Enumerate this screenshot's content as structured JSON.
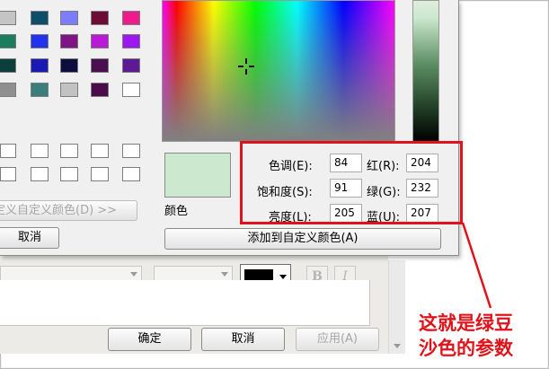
{
  "colors": {
    "accent_red": "#e0131b",
    "sample_color": "#cce8cf"
  },
  "basic_colors_grid": [
    [
      "#c4c4c4",
      "#0d4f6a",
      "#7d7dfc",
      "#6c0d36",
      "#ef1a8b"
    ],
    [
      "#197d5e",
      "#2233f0",
      "#7f1484",
      "#b81ad6",
      "#9c17f0"
    ],
    [
      "#0c3f3b",
      "#1a1ab2",
      "#0e0e3e",
      "#4b0f4f",
      "#5d1a95"
    ],
    [
      "#8f8f8f",
      "#3a7d7c",
      "#c2c2c2",
      "#4b0c4a",
      "#ffffff"
    ]
  ],
  "color_dialog": {
    "custom_colors_label": "定义自定义颜色(D) >>",
    "cancel_label": "取消",
    "color_label": "颜色",
    "hue_label": "色调(E):",
    "hue_value": "84",
    "sat_label": "饱和度(S):",
    "sat_value": "91",
    "lum_label": "亮度(L):",
    "lum_value": "205",
    "red_label": "红(R):",
    "red_value": "204",
    "green_label": "绿(G):",
    "green_value": "232",
    "blue_label": "蓝(U):",
    "blue_value": "207",
    "add_custom_label": "添加到自定义颜色(A)"
  },
  "font_dialog": {
    "bold_label": "B",
    "italic_label": "I",
    "ok_label": "确定",
    "cancel_label": "取消",
    "apply_label": "应用(A)"
  },
  "annotation": {
    "line1": "这就是绿豆",
    "line2": "沙色的参数"
  }
}
